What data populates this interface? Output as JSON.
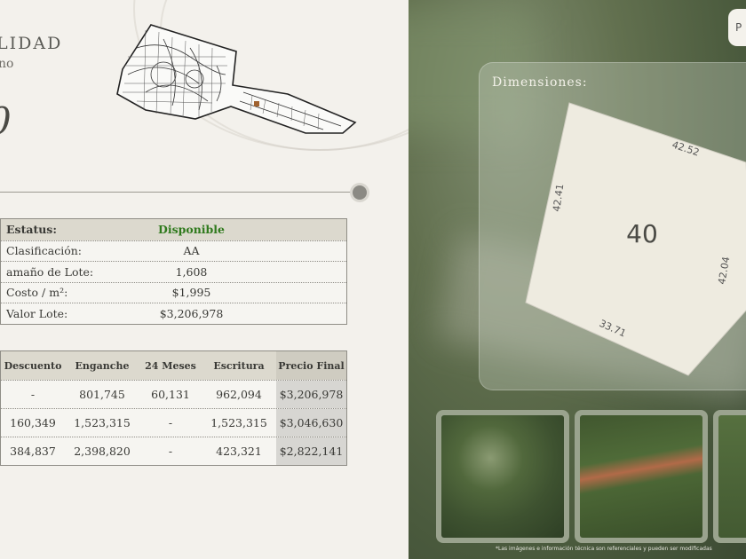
{
  "header": {
    "title": "LIDAD",
    "subtitle": "no",
    "lot_number": "0"
  },
  "status_table": {
    "rows": [
      {
        "label": "Estatus:",
        "value": "Disponible"
      },
      {
        "label": "Clasificación:",
        "value": "AA"
      },
      {
        "label": "amaño de Lote:",
        "value": "1,608"
      },
      {
        "label": "Costo / m²:",
        "value": "$1,995"
      },
      {
        "label": "Valor Lote:",
        "value": "$3,206,978"
      }
    ]
  },
  "price_table": {
    "headers": [
      "Descuento",
      "Enganche",
      "24 Meses",
      "Escritura",
      "Precio Final"
    ],
    "rows": [
      [
        "-",
        "801,745",
        "60,131",
        "962,094",
        "$3,206,978"
      ],
      [
        "160,349",
        "1,523,315",
        "-",
        "1,523,315",
        "$3,046,630"
      ],
      [
        "384,837",
        "2,398,820",
        "-",
        "423,321",
        "$2,822,141"
      ]
    ]
  },
  "dimensions": {
    "title": "Dimensiones:",
    "lot_label": "40",
    "sides": {
      "top": "42.52",
      "left": "42.41",
      "right": "42.04",
      "bottom": "33.71"
    }
  },
  "top_button": {
    "label": "P"
  },
  "disclaimer": "*Las imágenes e información técnica son referenciales y pueden ser modificadas",
  "colors": {
    "status_available": "#2f7a1d",
    "accent_gray": "#8b8a84"
  }
}
